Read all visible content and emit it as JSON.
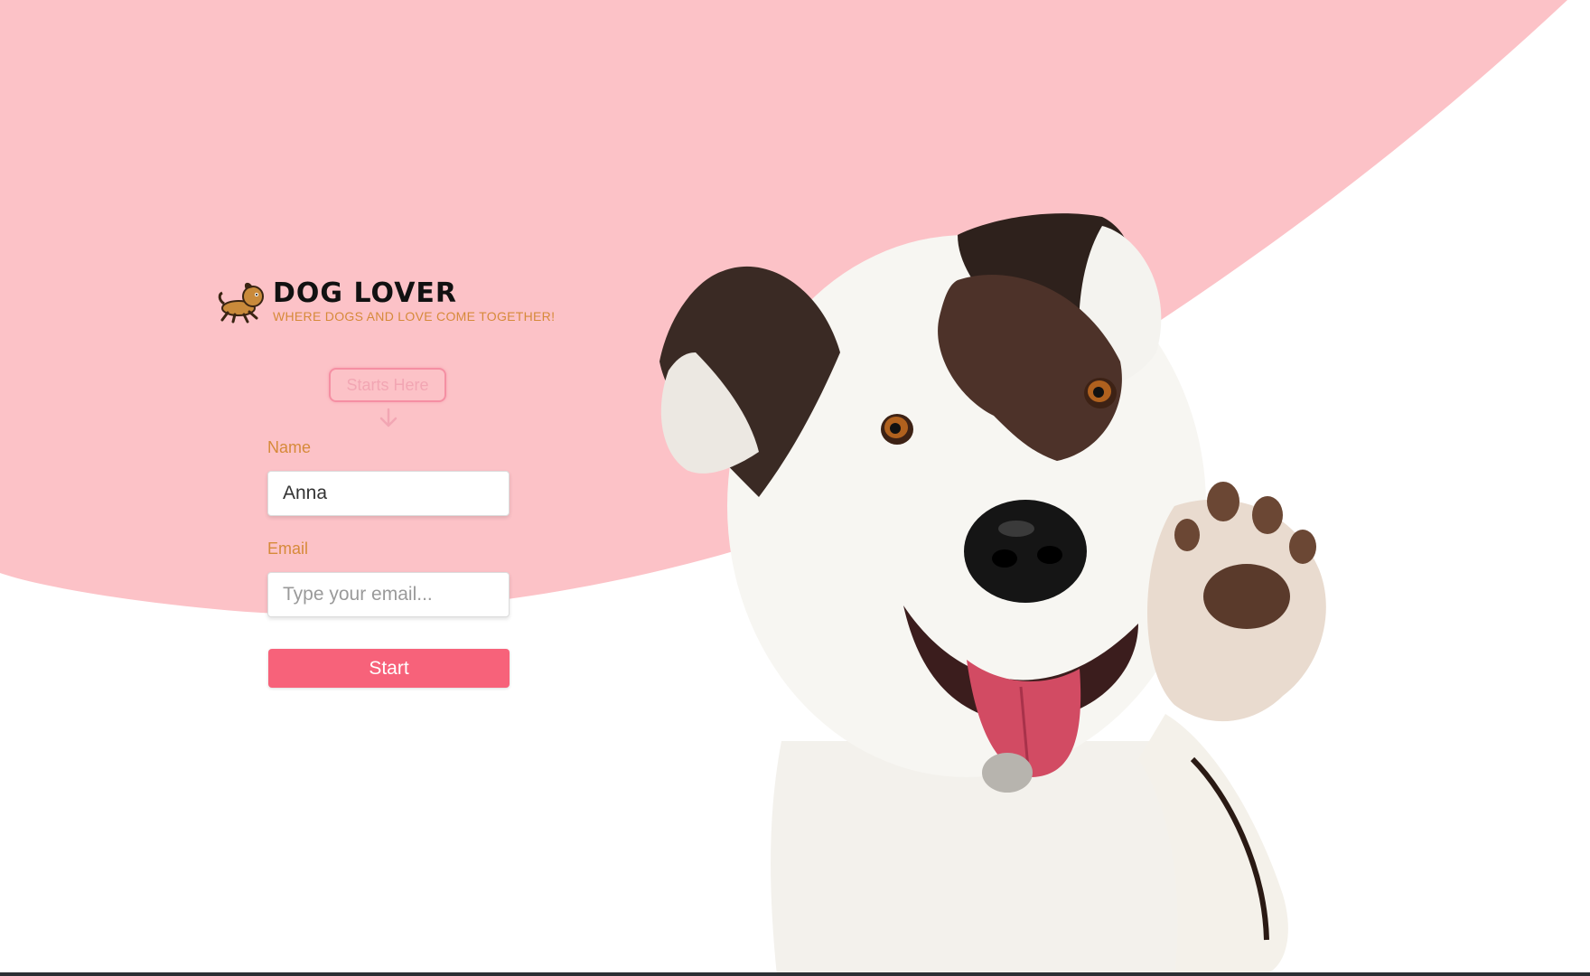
{
  "brand": {
    "logo_icon": "running-dog-icon",
    "title": "DOG LOVER",
    "tagline": "WHERE DOGS AND LOVE COME TOGETHER!"
  },
  "badge": {
    "label": "Starts Here",
    "arrow_icon": "arrow-down-icon"
  },
  "form": {
    "name_label": "Name",
    "name_value": "Anna",
    "email_label": "Email",
    "email_value": "",
    "email_placeholder": "Type your email...",
    "submit_label": "Start"
  },
  "hero": {
    "image": "waving-dog-photo"
  },
  "colors": {
    "background_pink": "#fcc2c7",
    "accent_button": "#f7627a",
    "label_orange": "#d68a3a",
    "badge_border": "#f58fa3"
  }
}
